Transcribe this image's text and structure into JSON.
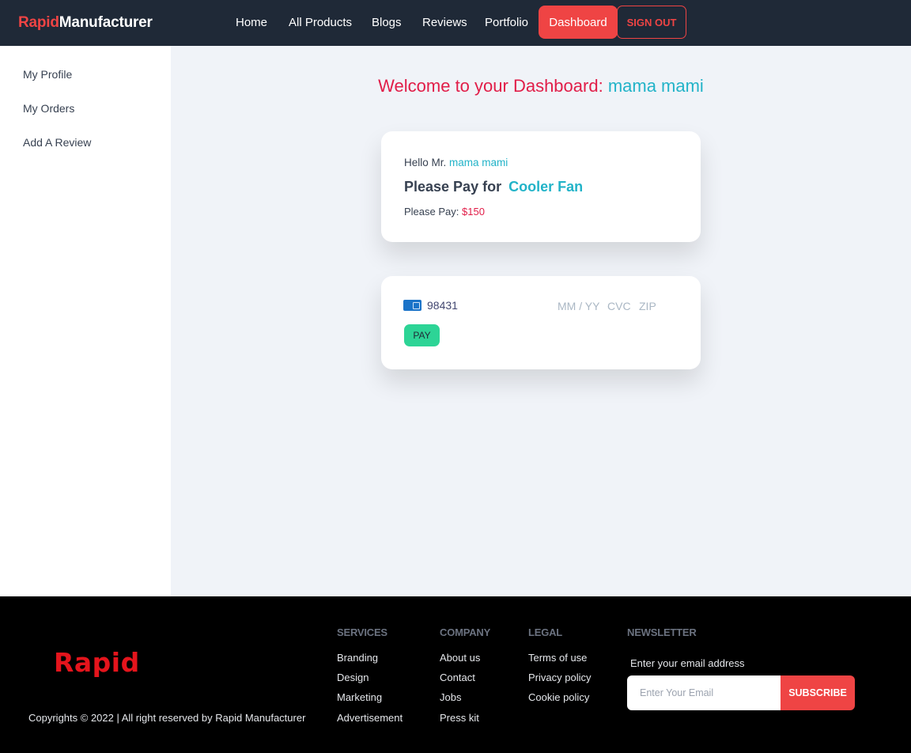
{
  "navbar": {
    "brand_accent": "Rapid",
    "brand_rest": "Manufacturer",
    "links": [
      "Home",
      "All Products",
      "Blogs",
      "Reviews",
      "Portfolio"
    ],
    "dashboard": "Dashboard",
    "signout": "SIGN OUT"
  },
  "sidebar": {
    "items": [
      "My Profile",
      "My Orders",
      "Add A Review"
    ]
  },
  "main": {
    "welcome_prefix": "Welcome to your Dashboard:",
    "user_name": "mama mami"
  },
  "order_card": {
    "hello_prefix": "Hello Mr.",
    "user_name": "mama mami",
    "pay_for_prefix": "Please Pay for",
    "product": "Cooler Fan",
    "pay_prefix": "Please Pay:",
    "amount": "$150"
  },
  "payment_card": {
    "card_icon": "credit-card-icon",
    "card_number": "98431",
    "expiry_placeholder": "MM / YY",
    "cvc_placeholder": "CVC",
    "zip_placeholder": "ZIP",
    "pay_label": "PAY"
  },
  "footer": {
    "logo": "Rapid",
    "copyright": "Copyrights © 2022 | All right reserved by Rapid Manufacturer",
    "services": {
      "title": "SERVICES",
      "links": [
        "Branding",
        "Design",
        "Marketing",
        "Advertisement"
      ]
    },
    "company": {
      "title": "COMPANY",
      "links": [
        "About us",
        "Contact",
        "Jobs",
        "Press kit"
      ]
    },
    "legal": {
      "title": "LEGAL",
      "links": [
        "Terms of use",
        "Privacy policy",
        "Cookie policy"
      ]
    },
    "newsletter": {
      "title": "NEWSLETTER",
      "label": "Enter your email address",
      "placeholder": "Enter Your Email",
      "button": "SUBSCRIBE"
    }
  },
  "colors": {
    "navbar_bg": "#1f2937",
    "accent_red": "#ef4444",
    "accent_teal": "#22b3c8",
    "pay_green": "#2dd496",
    "footer_bg": "#000000"
  }
}
